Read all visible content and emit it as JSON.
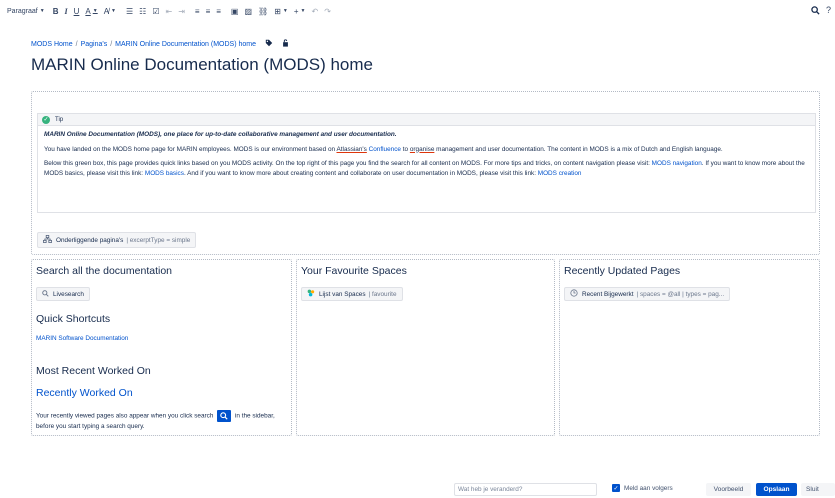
{
  "toolbar": {
    "paragraph_label": "Paragraaf",
    "bold": "B",
    "italic": "I",
    "underline": "U",
    "text_color": "A",
    "more_format": "A̸",
    "bullet_list": "☰",
    "numbered_list": "☷",
    "task_list": "☑",
    "outdent": "⇤",
    "indent": "⇥",
    "align_left": "≡",
    "align_center": "≡",
    "align_right": "≡",
    "layout": "▣",
    "image": "▨",
    "link": "⛓",
    "table": "⊞",
    "insert": "+",
    "undo": "↶",
    "redo": "↷",
    "search": "🔍",
    "help": "?"
  },
  "breadcrumb": {
    "items": [
      "MODS Home",
      "Pagina's",
      "MARIN Online Documentation (MODS) home"
    ],
    "separator": "/"
  },
  "page": {
    "title": "MARIN Online Documentation (MODS) home"
  },
  "tip": {
    "title": "Tip",
    "lead": "MARIN Online Documentation (MODS), one place for up-to-date collaborative management and user documentation.",
    "p1_a": "You have landed on the MODS home page for MARIN employees. MODS is our environment based on ",
    "p1_atlassian": "Atlassian's",
    "p1_space": " ",
    "p1_confluence": "Confluence",
    "p1_b": " to ",
    "p1_organise": "organise",
    "p1_c": " management and user documentation. The content in MODS is a mix of Dutch and English language.",
    "p2_a": "Below this green box, this page provides quick links based on you MODS activity. On the top right of this page you find the search for all content on MODS. For more tips and tricks, on content navigation please visit: ",
    "p2_nav_link": "MODS navigation",
    "p2_b": ". If you want to know more about the MODS basics, please visit this link: ",
    "p2_basics_link": "MODS basics",
    "p2_c": ". And if you want to know more about creating content and collaborate on user documentation in MODS, please visit this link: ",
    "p2_creation_link": "MODS creation"
  },
  "children_macro": {
    "name": "Onderliggende pagina's",
    "params": "| excerptType = simple"
  },
  "col1": {
    "search_heading": "Search all the documentation",
    "livesearch_label": "Livesearch",
    "shortcuts_heading": "Quick Shortcuts",
    "shortcut_link": "MARIN Software Documentation",
    "recent_heading": "Most Recent Worked On",
    "recent_link": "Recently Worked On",
    "note_a": "Your recently viewed pages also appear when you click search",
    "note_b": "in the sidebar, before you start typing a search query."
  },
  "col2": {
    "heading": "Your Favourite Spaces",
    "macro_name": "Lijst van Spaces",
    "macro_params": "| favourite"
  },
  "col3": {
    "heading": "Recently Updated Pages",
    "macro_name": "Recent Bijgewerkt",
    "macro_params": "| spaces = @all | types = pag..."
  },
  "footer": {
    "comment_placeholder": "Wat heb je veranderd?",
    "notify_label": "Meld aan volgers",
    "preview_label": "Voorbeeld",
    "save_label": "Opslaan",
    "close_label": "Sluit"
  },
  "colors": {
    "accent": "#0052cc",
    "tip_green": "#36b37e",
    "text": "#172b4d"
  }
}
